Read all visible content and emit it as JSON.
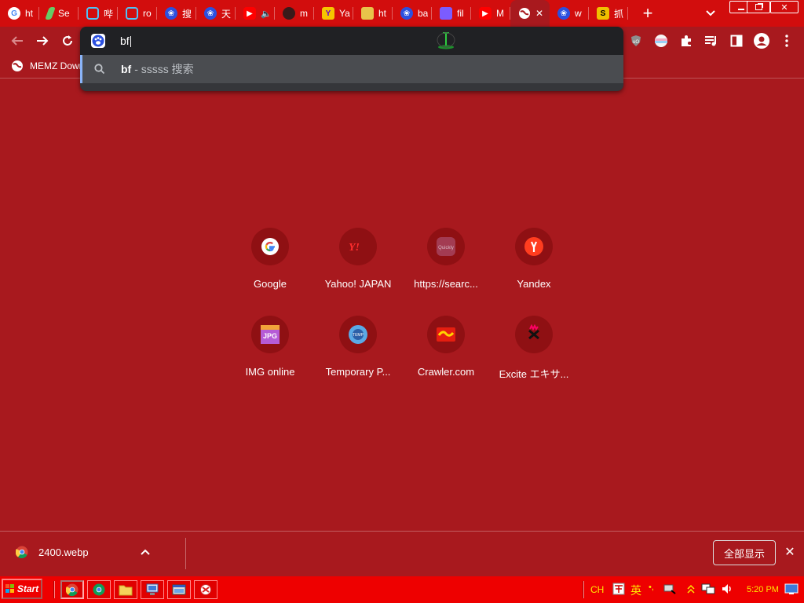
{
  "tabs": [
    {
      "title": "ht",
      "icon": "google-icon"
    },
    {
      "title": "Se",
      "icon": "green-leaf-icon"
    },
    {
      "title": "哔",
      "icon": "bilibili-icon"
    },
    {
      "title": "ro",
      "icon": "bilibili-icon"
    },
    {
      "title": "搜",
      "icon": "baidu-paw-icon"
    },
    {
      "title": "天",
      "icon": "baidu-paw-icon"
    },
    {
      "title": "",
      "icon": "youtube-icon",
      "audio": "speaker-icon"
    },
    {
      "title": "m",
      "icon": "dark-circle-icon"
    },
    {
      "title": "Ya",
      "icon": "yahoo-icon"
    },
    {
      "title": "ht",
      "icon": "picture-icon"
    },
    {
      "title": "ba",
      "icon": "baidu-paw-icon"
    },
    {
      "title": "fil",
      "icon": "purple-shape-icon"
    },
    {
      "title": "M",
      "icon": "youtube-icon"
    },
    {
      "title": "",
      "icon": "globe-icon",
      "active": true
    },
    {
      "title": "w",
      "icon": "baidu-paw-icon"
    },
    {
      "title": "抓",
      "icon": "s-badge-icon"
    }
  ],
  "omnibox": {
    "typed": "bf",
    "suggestion_query": "bf",
    "suggestion_source": "- sssss 搜索"
  },
  "bookmarks": [
    {
      "label": "MEMZ Dowr"
    }
  ],
  "shortcuts": [
    {
      "label": "Google",
      "icon": "google-icon"
    },
    {
      "label": "Yahoo! JAPAN",
      "icon": "yahoo-japan-icon"
    },
    {
      "label": "https://searc...",
      "icon": "quickly-icon"
    },
    {
      "label": "Yandex",
      "icon": "yandex-icon"
    },
    {
      "label": "IMG online",
      "icon": "jpg-icon"
    },
    {
      "label": "Temporary P...",
      "icon": "temp-phone-icon"
    },
    {
      "label": "Crawler.com",
      "icon": "crawler-icon"
    },
    {
      "label": "Excite エキサ...",
      "icon": "excite-icon"
    }
  ],
  "downloads": {
    "file": "2400.webp",
    "show_all": "全部显示"
  },
  "taskbar": {
    "start": "Start",
    "lang": "CH",
    "ime": "英",
    "ime_punct": "•,",
    "clock": "5:20 PM"
  },
  "colors": {
    "background": "#a8191e",
    "tabstrip": "#d20d0d",
    "taskbar": "#ee0000",
    "omnibox": "#35363a"
  }
}
